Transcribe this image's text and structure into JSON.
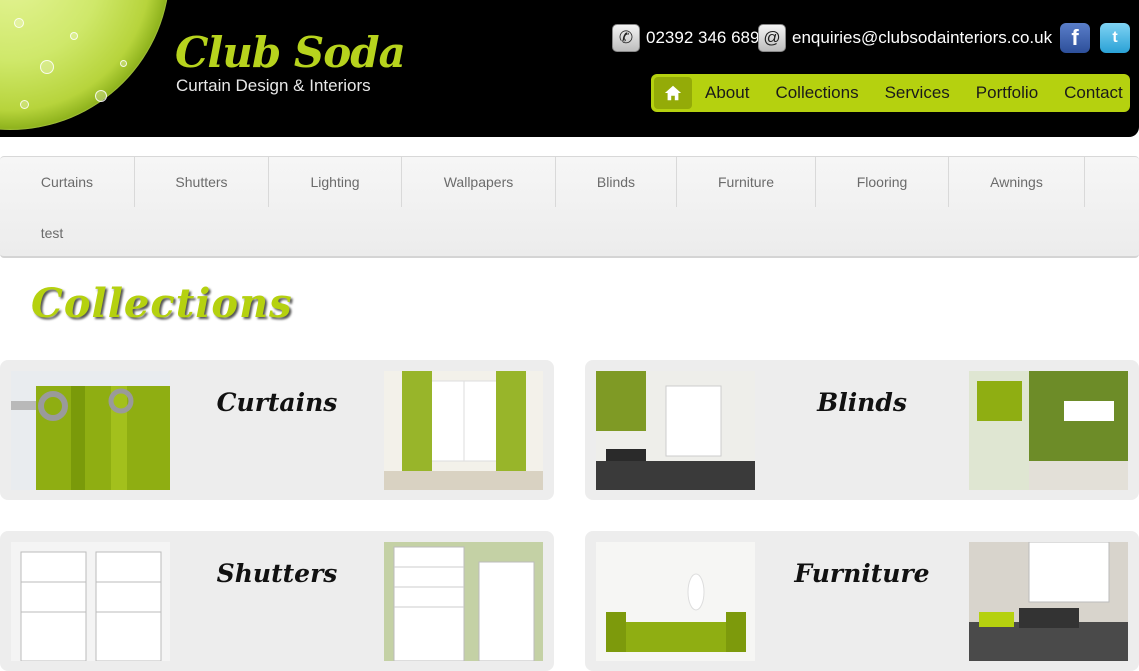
{
  "brand": {
    "name": "Club Soda",
    "tagline": "Curtain Design & Interiors"
  },
  "contact": {
    "phone": "02392 346 689",
    "email": "enquiries@clubsodainteriors.co.uk",
    "phone_icon": "phone-icon",
    "email_icon": "at-sign-icon"
  },
  "social": {
    "facebook_glyph": "f",
    "twitter_glyph": "t"
  },
  "main_nav": {
    "home_icon": "home-icon",
    "items": [
      "About",
      "Collections",
      "Services",
      "Portfolio",
      "Contact"
    ]
  },
  "categories": [
    "Curtains",
    "Shutters",
    "Lighting",
    "Wallpapers",
    "Blinds",
    "Furniture",
    "Flooring",
    "Awnings",
    "test"
  ],
  "page_heading": "Collections",
  "collections": [
    {
      "label": "Curtains"
    },
    {
      "label": "Blinds"
    },
    {
      "label": "Shutters"
    },
    {
      "label": "Furniture"
    }
  ],
  "colors": {
    "accent": "#b5d10f",
    "header_bg": "#000000",
    "panel_bg": "#ededed",
    "category_text": "#6b6b6b"
  }
}
